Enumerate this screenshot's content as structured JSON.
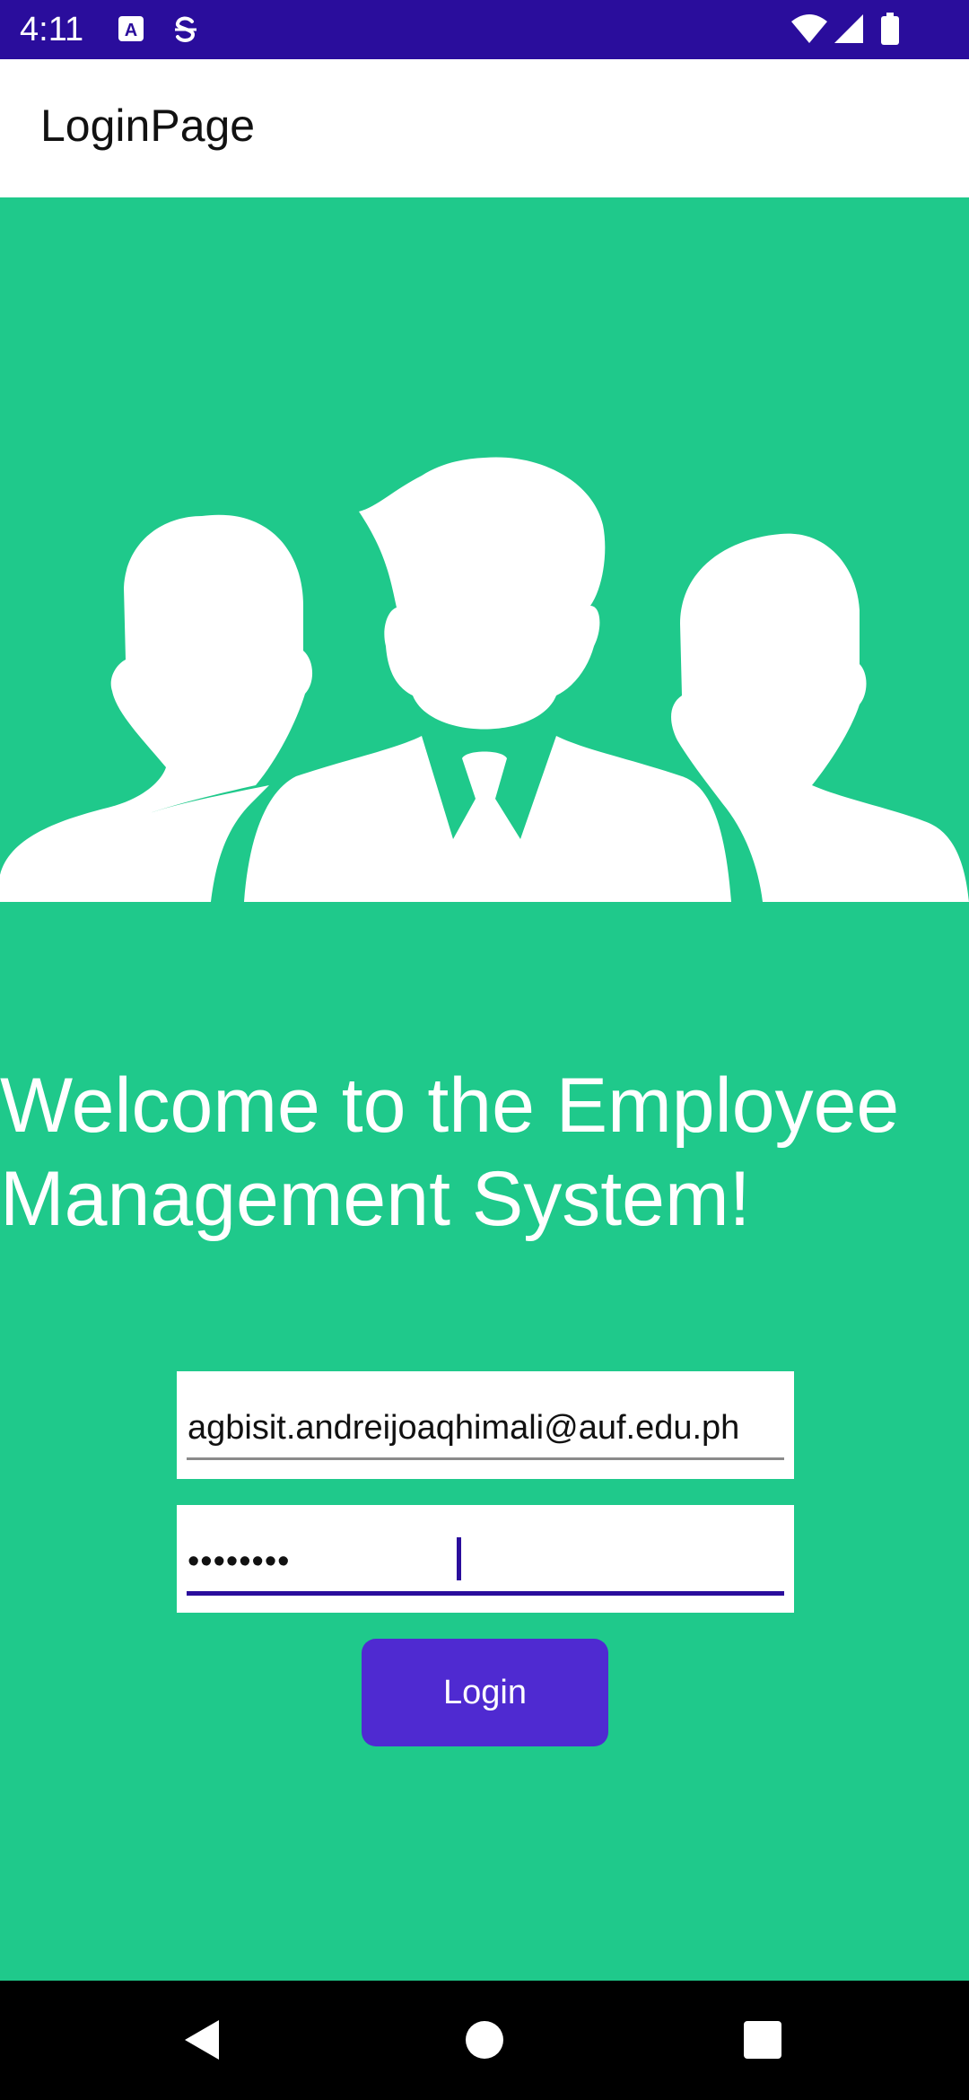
{
  "status_bar": {
    "time": "4:11",
    "icons": [
      "font-notification-icon",
      "sync-notification-icon",
      "wifi-icon",
      "signal-icon",
      "battery-icon"
    ]
  },
  "app_bar": {
    "title": "LoginPage"
  },
  "hero": {
    "icon": "people-group-icon"
  },
  "welcome": {
    "text": "Welcome to the Employee Management System!"
  },
  "form": {
    "email_value": "agbisit.andreijoaqhimali@auf.edu.ph",
    "password_value": "••••••••",
    "login_label": "Login"
  },
  "nav_bar": {
    "icons": [
      "back-icon",
      "home-icon",
      "recents-icon"
    ]
  },
  "colors": {
    "status_bar": "#2a0d9c",
    "background": "#1fc98b",
    "button": "#4f2ad1",
    "focus_underline": "#2a0d9c"
  }
}
